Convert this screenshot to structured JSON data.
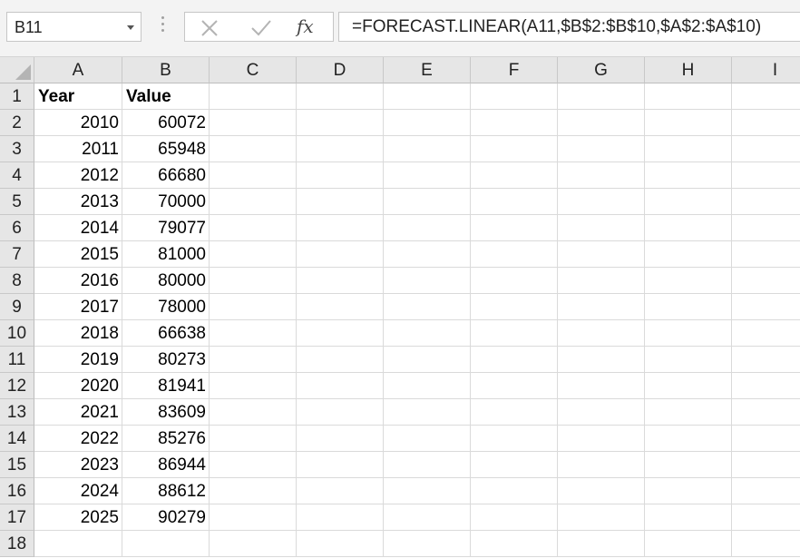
{
  "name_box": {
    "value": "B11"
  },
  "formula_bar": {
    "cancel_icon": "close-icon",
    "enter_icon": "check-icon",
    "fx_label": "fx",
    "formula": "=FORECAST.LINEAR(A11,$B$2:$B$10,$A$2:$A$10)"
  },
  "columns": [
    "A",
    "B",
    "C",
    "D",
    "E",
    "F",
    "G",
    "H",
    "I"
  ],
  "rows": [
    "1",
    "2",
    "3",
    "4",
    "5",
    "6",
    "7",
    "8",
    "9",
    "10",
    "11",
    "12",
    "13",
    "14",
    "15",
    "16",
    "17",
    "18"
  ],
  "table": {
    "headers": [
      "Year",
      "Value"
    ],
    "data": [
      [
        "2010",
        "60072"
      ],
      [
        "2011",
        "65948"
      ],
      [
        "2012",
        "66680"
      ],
      [
        "2013",
        "70000"
      ],
      [
        "2014",
        "79077"
      ],
      [
        "2015",
        "81000"
      ],
      [
        "2016",
        "80000"
      ],
      [
        "2017",
        "78000"
      ],
      [
        "2018",
        "66638"
      ],
      [
        "2019",
        "80273"
      ],
      [
        "2020",
        "81941"
      ],
      [
        "2021",
        "83609"
      ],
      [
        "2022",
        "85276"
      ],
      [
        "2023",
        "86944"
      ],
      [
        "2024",
        "88612"
      ],
      [
        "2025",
        "90279"
      ]
    ]
  }
}
